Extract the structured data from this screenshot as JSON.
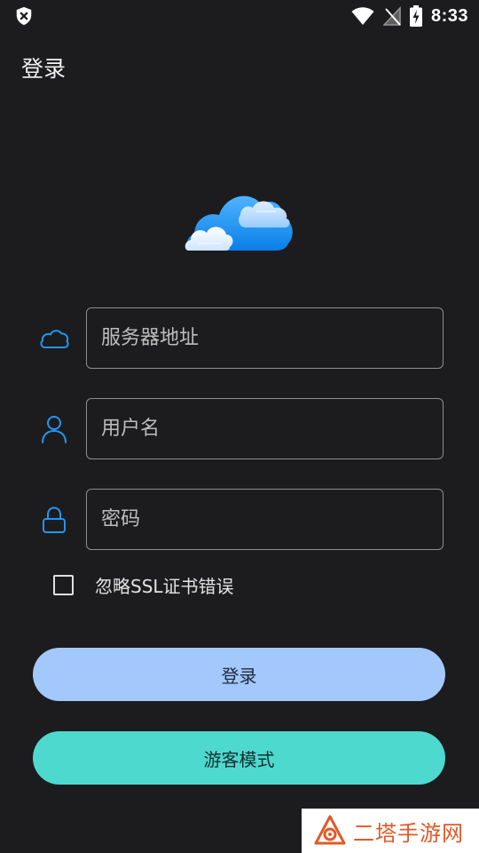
{
  "status_bar": {
    "time": "8:33",
    "left_icon": "shield-x-icon",
    "right_icons": [
      "wifi-icon",
      "no-signal-icon",
      "battery-charging-icon"
    ]
  },
  "header": {
    "title": "登录"
  },
  "logo": {
    "icon": "cloud-logo-icon",
    "colors": [
      "#0a84ff",
      "#4fb3ff",
      "#e8f2ff"
    ]
  },
  "form": {
    "server": {
      "icon": "cloud-outline-icon",
      "placeholder": "服务器地址",
      "value": ""
    },
    "username": {
      "icon": "user-icon",
      "placeholder": "用户名",
      "value": ""
    },
    "password": {
      "icon": "lock-icon",
      "placeholder": "密码",
      "value": ""
    },
    "ignore_ssl": {
      "label": "忽略SSL证书错误",
      "checked": false
    }
  },
  "buttons": {
    "login": "登录",
    "guest": "游客模式"
  },
  "watermark": {
    "text": "二塔手游网",
    "icon": "watermark-logo-icon"
  },
  "colors": {
    "background": "#1c1c1e",
    "accent": "#2196f3",
    "login_button": "#a3c8fb",
    "guest_button": "#4ed9cf"
  }
}
